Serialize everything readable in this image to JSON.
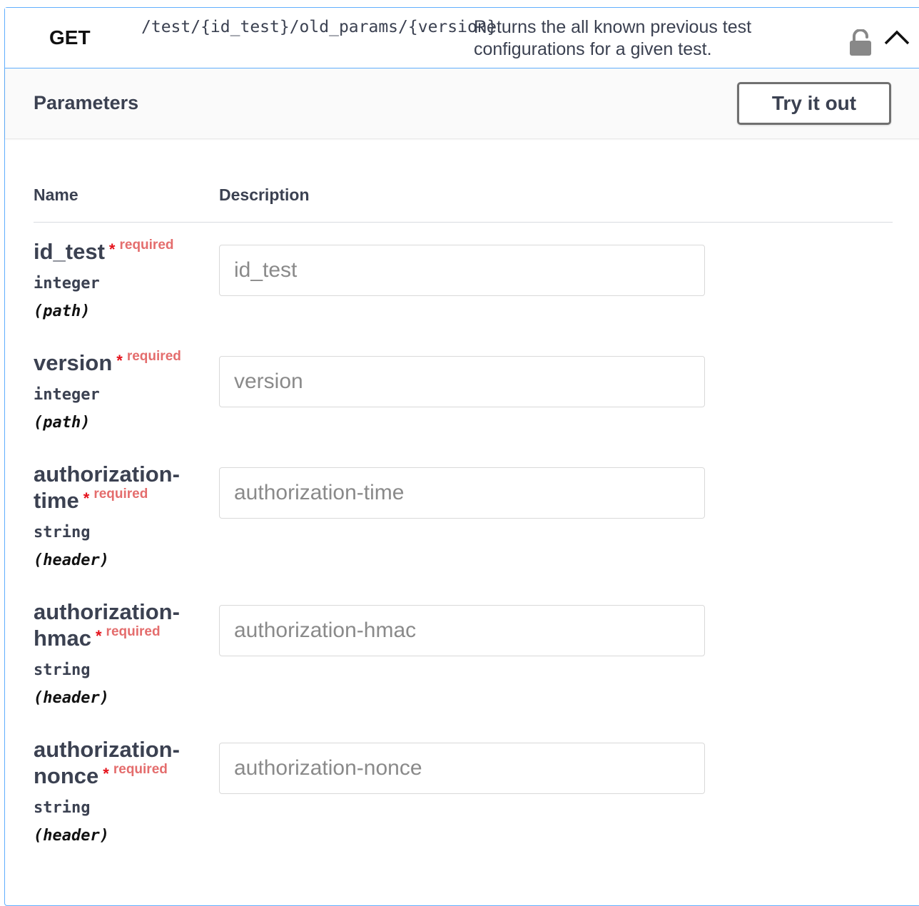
{
  "operation": {
    "method": "GET",
    "path": "/test/{id_test}/old_params/{version}",
    "description": "Returns the all known previous test configurations for a given test.",
    "lock_icon": "lock-open-icon",
    "chevron_icon": "chevron-up-icon",
    "colors": {
      "accent": "#61affe",
      "required": "#e5121b"
    }
  },
  "section": {
    "title": "Parameters",
    "try_button": "Try it out"
  },
  "table": {
    "headers": {
      "name": "Name",
      "description": "Description"
    },
    "params": [
      {
        "name_line1": "id_test",
        "name_line2": "",
        "type": "integer",
        "in": "(path)",
        "placeholder": "id_test",
        "required_star": "*",
        "required_label": "required"
      },
      {
        "name_line1": "version",
        "name_line2": "",
        "type": "integer",
        "in": "(path)",
        "placeholder": "version",
        "required_star": "*",
        "required_label": "required"
      },
      {
        "name_line1": "authorization-",
        "name_line2": "time",
        "type": "string",
        "in": "(header)",
        "placeholder": "authorization-time",
        "required_star": "*",
        "required_label": "required"
      },
      {
        "name_line1": "authorization-",
        "name_line2": "hmac",
        "type": "string",
        "in": "(header)",
        "placeholder": "authorization-hmac",
        "required_star": "*",
        "required_label": "required"
      },
      {
        "name_line1": "authorization-",
        "name_line2": "nonce",
        "type": "string",
        "in": "(header)",
        "placeholder": "authorization-nonce",
        "required_star": "*",
        "required_label": "required"
      }
    ]
  }
}
